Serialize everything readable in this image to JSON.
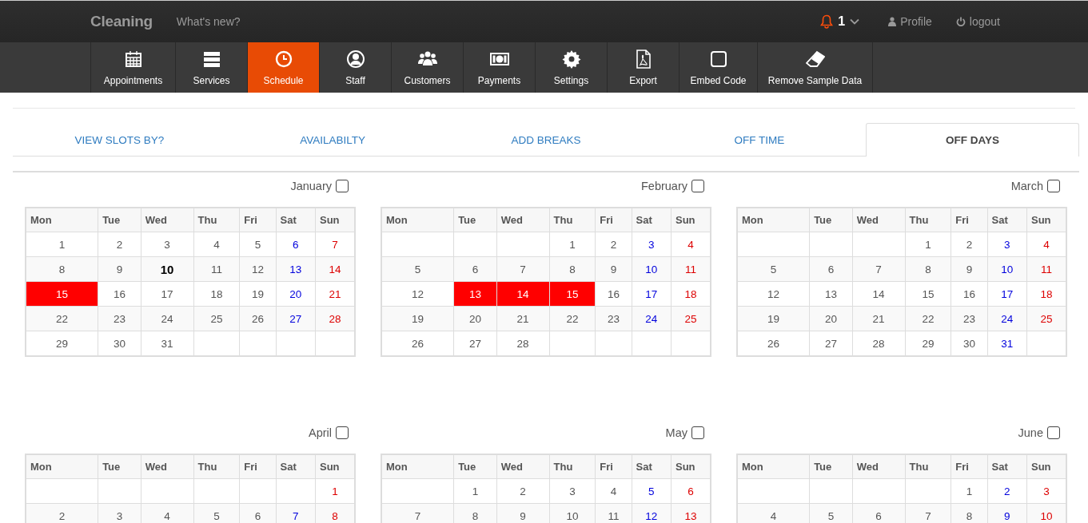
{
  "header": {
    "brand": "Cleaning",
    "whats_new": "What's new?",
    "notifications": "1",
    "profile": "Profile",
    "logout": "logout"
  },
  "nav": [
    {
      "label": "Appointments",
      "selected": false
    },
    {
      "label": "Services",
      "selected": false
    },
    {
      "label": "Schedule",
      "selected": true
    },
    {
      "label": "Staff",
      "selected": false
    },
    {
      "label": "Customers",
      "selected": false
    },
    {
      "label": "Payments",
      "selected": false
    },
    {
      "label": "Settings",
      "selected": false
    },
    {
      "label": "Export",
      "selected": false
    },
    {
      "label": "Embed Code",
      "selected": false
    },
    {
      "label": "Remove Sample Data",
      "selected": false
    }
  ],
  "tabs": [
    {
      "label": "VIEW SLOTS BY?",
      "selected": false
    },
    {
      "label": "AVAILABILTY",
      "selected": false
    },
    {
      "label": "ADD BREAKS",
      "selected": false
    },
    {
      "label": "OFF TIME",
      "selected": false
    },
    {
      "label": "OFF DAYS",
      "selected": true
    }
  ],
  "months": [
    {
      "name": "January",
      "checked": false,
      "weekdays": [
        "Mon",
        "Tue",
        "Wed",
        "Thu",
        "Fri",
        "Sat",
        "Sun"
      ],
      "weeks": [
        [
          {
            "day": "1",
            "off": false,
            "today": false
          },
          {
            "day": "2",
            "off": false,
            "today": false
          },
          {
            "day": "3",
            "off": false,
            "today": false
          },
          {
            "day": "4",
            "off": false,
            "today": false
          },
          {
            "day": "5",
            "off": false,
            "today": false
          },
          {
            "day": "6",
            "off": false,
            "today": false
          },
          {
            "day": "7",
            "off": false,
            "today": false
          }
        ],
        [
          {
            "day": "8",
            "off": false,
            "today": false
          },
          {
            "day": "9",
            "off": false,
            "today": false
          },
          {
            "day": "10",
            "off": false,
            "today": true
          },
          {
            "day": "11",
            "off": false,
            "today": false
          },
          {
            "day": "12",
            "off": false,
            "today": false
          },
          {
            "day": "13",
            "off": false,
            "today": false
          },
          {
            "day": "14",
            "off": false,
            "today": false
          }
        ],
        [
          {
            "day": "15",
            "off": true,
            "today": false
          },
          {
            "day": "16",
            "off": false,
            "today": false
          },
          {
            "day": "17",
            "off": false,
            "today": false
          },
          {
            "day": "18",
            "off": false,
            "today": false
          },
          {
            "day": "19",
            "off": false,
            "today": false
          },
          {
            "day": "20",
            "off": false,
            "today": false
          },
          {
            "day": "21",
            "off": false,
            "today": false
          }
        ],
        [
          {
            "day": "22",
            "off": false,
            "today": false
          },
          {
            "day": "23",
            "off": false,
            "today": false
          },
          {
            "day": "24",
            "off": false,
            "today": false
          },
          {
            "day": "25",
            "off": false,
            "today": false
          },
          {
            "day": "26",
            "off": false,
            "today": false
          },
          {
            "day": "27",
            "off": false,
            "today": false
          },
          {
            "day": "28",
            "off": false,
            "today": false
          }
        ],
        [
          {
            "day": "29",
            "off": false,
            "today": false
          },
          {
            "day": "30",
            "off": false,
            "today": false
          },
          {
            "day": "31",
            "off": false,
            "today": false
          },
          {
            "kind": "empty"
          },
          {
            "kind": "empty"
          },
          {
            "kind": "empty"
          },
          {
            "kind": "empty"
          }
        ]
      ]
    },
    {
      "name": "February",
      "checked": false,
      "weekdays": [
        "Mon",
        "Tue",
        "Wed",
        "Thu",
        "Fri",
        "Sat",
        "Sun"
      ],
      "weeks": [
        [
          {
            "kind": "empty"
          },
          {
            "kind": "empty"
          },
          {
            "kind": "empty"
          },
          {
            "day": "1",
            "off": false,
            "today": false
          },
          {
            "day": "2",
            "off": false,
            "today": false
          },
          {
            "day": "3",
            "off": false,
            "today": false
          },
          {
            "day": "4",
            "off": false,
            "today": false
          }
        ],
        [
          {
            "day": "5",
            "off": false,
            "today": false
          },
          {
            "day": "6",
            "off": false,
            "today": false
          },
          {
            "day": "7",
            "off": false,
            "today": false
          },
          {
            "day": "8",
            "off": false,
            "today": false
          },
          {
            "day": "9",
            "off": false,
            "today": false
          },
          {
            "day": "10",
            "off": false,
            "today": false
          },
          {
            "day": "11",
            "off": false,
            "today": false
          }
        ],
        [
          {
            "day": "12",
            "off": false,
            "today": false
          },
          {
            "day": "13",
            "off": true,
            "today": false
          },
          {
            "day": "14",
            "off": true,
            "today": false
          },
          {
            "day": "15",
            "off": true,
            "today": false
          },
          {
            "day": "16",
            "off": false,
            "today": false
          },
          {
            "day": "17",
            "off": false,
            "today": false
          },
          {
            "day": "18",
            "off": false,
            "today": false
          }
        ],
        [
          {
            "day": "19",
            "off": false,
            "today": false
          },
          {
            "day": "20",
            "off": false,
            "today": false
          },
          {
            "day": "21",
            "off": false,
            "today": false
          },
          {
            "day": "22",
            "off": false,
            "today": false
          },
          {
            "day": "23",
            "off": false,
            "today": false
          },
          {
            "day": "24",
            "off": false,
            "today": false
          },
          {
            "day": "25",
            "off": false,
            "today": false
          }
        ],
        [
          {
            "day": "26",
            "off": false,
            "today": false
          },
          {
            "day": "27",
            "off": false,
            "today": false
          },
          {
            "day": "28",
            "off": false,
            "today": false
          },
          {
            "kind": "empty"
          },
          {
            "kind": "empty"
          },
          {
            "kind": "empty"
          },
          {
            "kind": "empty"
          }
        ]
      ]
    },
    {
      "name": "March",
      "checked": false,
      "weekdays": [
        "Mon",
        "Tue",
        "Wed",
        "Thu",
        "Fri",
        "Sat",
        "Sun"
      ],
      "weeks": [
        [
          {
            "kind": "empty"
          },
          {
            "kind": "empty"
          },
          {
            "kind": "empty"
          },
          {
            "day": "1",
            "off": false,
            "today": false
          },
          {
            "day": "2",
            "off": false,
            "today": false
          },
          {
            "day": "3",
            "off": false,
            "today": false
          },
          {
            "day": "4",
            "off": false,
            "today": false
          }
        ],
        [
          {
            "day": "5",
            "off": false,
            "today": false
          },
          {
            "day": "6",
            "off": false,
            "today": false
          },
          {
            "day": "7",
            "off": false,
            "today": false
          },
          {
            "day": "8",
            "off": false,
            "today": false
          },
          {
            "day": "9",
            "off": false,
            "today": false
          },
          {
            "day": "10",
            "off": false,
            "today": false
          },
          {
            "day": "11",
            "off": false,
            "today": false
          }
        ],
        [
          {
            "day": "12",
            "off": false,
            "today": false
          },
          {
            "day": "13",
            "off": false,
            "today": false
          },
          {
            "day": "14",
            "off": false,
            "today": false
          },
          {
            "day": "15",
            "off": false,
            "today": false
          },
          {
            "day": "16",
            "off": false,
            "today": false
          },
          {
            "day": "17",
            "off": false,
            "today": false
          },
          {
            "day": "18",
            "off": false,
            "today": false
          }
        ],
        [
          {
            "day": "19",
            "off": false,
            "today": false
          },
          {
            "day": "20",
            "off": false,
            "today": false
          },
          {
            "day": "21",
            "off": false,
            "today": false
          },
          {
            "day": "22",
            "off": false,
            "today": false
          },
          {
            "day": "23",
            "off": false,
            "today": false
          },
          {
            "day": "24",
            "off": false,
            "today": false
          },
          {
            "day": "25",
            "off": false,
            "today": false
          }
        ],
        [
          {
            "day": "26",
            "off": false,
            "today": false
          },
          {
            "day": "27",
            "off": false,
            "today": false
          },
          {
            "day": "28",
            "off": false,
            "today": false
          },
          {
            "day": "29",
            "off": false,
            "today": false
          },
          {
            "day": "30",
            "off": false,
            "today": false
          },
          {
            "day": "31",
            "off": false,
            "today": false
          },
          {
            "kind": "empty"
          }
        ]
      ]
    },
    {
      "name": "April",
      "checked": false,
      "weekdays": [
        "Mon",
        "Tue",
        "Wed",
        "Thu",
        "Fri",
        "Sat",
        "Sun"
      ],
      "weeks": [
        [
          {
            "kind": "empty"
          },
          {
            "kind": "empty"
          },
          {
            "kind": "empty"
          },
          {
            "kind": "empty"
          },
          {
            "kind": "empty"
          },
          {
            "kind": "empty"
          },
          {
            "day": "1",
            "off": false,
            "today": false
          }
        ],
        [
          {
            "day": "2",
            "off": false,
            "today": false
          },
          {
            "day": "3",
            "off": false,
            "today": false
          },
          {
            "day": "4",
            "off": false,
            "today": false
          },
          {
            "day": "5",
            "off": false,
            "today": false
          },
          {
            "day": "6",
            "off": false,
            "today": false
          },
          {
            "day": "7",
            "off": false,
            "today": false
          },
          {
            "day": "8",
            "off": false,
            "today": false
          }
        ]
      ]
    },
    {
      "name": "May",
      "checked": false,
      "weekdays": [
        "Mon",
        "Tue",
        "Wed",
        "Thu",
        "Fri",
        "Sat",
        "Sun"
      ],
      "weeks": [
        [
          {
            "kind": "empty"
          },
          {
            "day": "1",
            "off": false,
            "today": false
          },
          {
            "day": "2",
            "off": false,
            "today": false
          },
          {
            "day": "3",
            "off": false,
            "today": false
          },
          {
            "day": "4",
            "off": false,
            "today": false
          },
          {
            "day": "5",
            "off": false,
            "today": false
          },
          {
            "day": "6",
            "off": false,
            "today": false
          }
        ],
        [
          {
            "day": "7",
            "off": false,
            "today": false
          },
          {
            "day": "8",
            "off": false,
            "today": false
          },
          {
            "day": "9",
            "off": false,
            "today": false
          },
          {
            "day": "10",
            "off": false,
            "today": false
          },
          {
            "day": "11",
            "off": false,
            "today": false
          },
          {
            "day": "12",
            "off": false,
            "today": false
          },
          {
            "day": "13",
            "off": false,
            "today": false
          }
        ]
      ]
    },
    {
      "name": "June",
      "checked": false,
      "weekdays": [
        "Mon",
        "Tue",
        "Wed",
        "Thu",
        "Fri",
        "Sat",
        "Sun"
      ],
      "weeks": [
        [
          {
            "kind": "empty"
          },
          {
            "kind": "empty"
          },
          {
            "kind": "empty"
          },
          {
            "kind": "empty"
          },
          {
            "day": "1",
            "off": false,
            "today": false
          },
          {
            "day": "2",
            "off": false,
            "today": false
          },
          {
            "day": "3",
            "off": false,
            "today": false
          }
        ],
        [
          {
            "day": "4",
            "off": false,
            "today": false
          },
          {
            "day": "5",
            "off": false,
            "today": false
          },
          {
            "day": "6",
            "off": false,
            "today": false
          },
          {
            "day": "7",
            "off": false,
            "today": false
          },
          {
            "day": "8",
            "off": false,
            "today": false
          },
          {
            "day": "9",
            "off": false,
            "today": false
          },
          {
            "day": "10",
            "off": false,
            "today": false
          }
        ]
      ]
    }
  ]
}
